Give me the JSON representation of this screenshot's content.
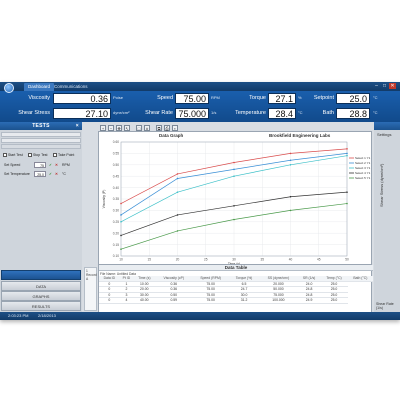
{
  "titlebar": {
    "tabs": [
      "Dashboard",
      "Communications"
    ],
    "controls": [
      "–",
      "□",
      "✕"
    ]
  },
  "readings": [
    {
      "label": "Viscosity",
      "value": "0.36",
      "unit": "Poise"
    },
    {
      "label": "Shear Stress",
      "value": "27.10",
      "unit": "dyne/cm²"
    },
    {
      "label": "Speed",
      "value": "75.00",
      "unit": "RPM"
    },
    {
      "label": "Shear Rate",
      "value": "75.000",
      "unit": "1/s"
    },
    {
      "label": "Torque",
      "value": "27.1",
      "unit": "%"
    },
    {
      "label": "Temperature",
      "value": "28.4",
      "unit": "°C"
    },
    {
      "label": "Setpoint",
      "value": "25.0",
      "unit": "°C"
    },
    {
      "label": "Bath",
      "value": "28.8",
      "unit": "°C"
    }
  ],
  "left": {
    "title": "TESTS",
    "checks": [
      "Start Test",
      "Stop Test",
      "Take Point"
    ],
    "set_speed": {
      "label": "Set Speed",
      "value": "75",
      "unit": "RPM"
    },
    "set_temp": {
      "label": "Set Temperature",
      "value": "25.0",
      "unit": "°C"
    },
    "nav": [
      "DATA",
      "GRAPHS",
      "RESULTS"
    ]
  },
  "graph": {
    "title": "Data Graph",
    "company": "Brookfield Engineering Labs"
  },
  "chart_data": {
    "type": "line",
    "xlabel": "Time (s)",
    "ylabel": "Viscosity (P)",
    "y2label": "Shear Stress (dyne/cm²)",
    "xlim": [
      10,
      50
    ],
    "ylim": [
      0.1,
      0.6
    ],
    "x": [
      10,
      20,
      30,
      40,
      50
    ],
    "x_ticks": [
      10,
      15,
      20,
      25,
      30,
      35,
      40,
      45,
      50
    ],
    "y_ticks": [
      0.1,
      0.15,
      0.2,
      0.25,
      0.3,
      0.35,
      0.4,
      0.45,
      0.5,
      0.55,
      0.6
    ],
    "series": [
      {
        "name": "Select 1 Y1",
        "color": "#d94c4c",
        "values": [
          0.33,
          0.46,
          0.51,
          0.55,
          0.57
        ]
      },
      {
        "name": "Select 2 Y1",
        "color": "#3a8fd6",
        "values": [
          0.28,
          0.44,
          0.48,
          0.52,
          0.55
        ]
      },
      {
        "name": "Select 3 Y1",
        "color": "#3cc0c8",
        "values": [
          0.25,
          0.38,
          0.45,
          0.5,
          0.54
        ]
      },
      {
        "name": "Select 4 Y1",
        "color": "#333333",
        "values": [
          0.19,
          0.28,
          0.32,
          0.36,
          0.38
        ]
      },
      {
        "name": "Select 5 Y1",
        "color": "#4a9a4a",
        "values": [
          0.13,
          0.21,
          0.26,
          0.3,
          0.33
        ]
      }
    ]
  },
  "table": {
    "title": "Data Table",
    "record_info": "File Name: Untitled Data",
    "record_side": [
      "1",
      "Record",
      "A"
    ],
    "columns": [
      "Data ID",
      "Pt ID",
      "Time (s)",
      "Viscosity (cP)",
      "Speed (RPM)",
      "Torque (%)",
      "SS (dyne/cm²)",
      "SR (1/s)",
      "Temp (°C)",
      "Bath (°C)"
    ],
    "rows": [
      [
        "0",
        "1",
        "10.00",
        "0.36",
        "75.00",
        "6.5",
        "20.000",
        "24.0",
        "25.0"
      ],
      [
        "0",
        "2",
        "20.00",
        "0.36",
        "75.00",
        "24.7",
        "50.000",
        "24.8",
        "25.0"
      ],
      [
        "0",
        "3",
        "30.00",
        "0.50",
        "75.00",
        "30.0",
        "75.000",
        "24.8",
        "25.0"
      ],
      [
        "0",
        "4",
        "40.00",
        "0.59",
        "75.00",
        "31.2",
        "100.000",
        "24.9",
        "25.0"
      ]
    ]
  },
  "right": {
    "label": "Settings",
    "note": "Shear Rate (1/s)"
  },
  "status": {
    "time": "2:03:23 PM",
    "date": "2/18/2013"
  }
}
